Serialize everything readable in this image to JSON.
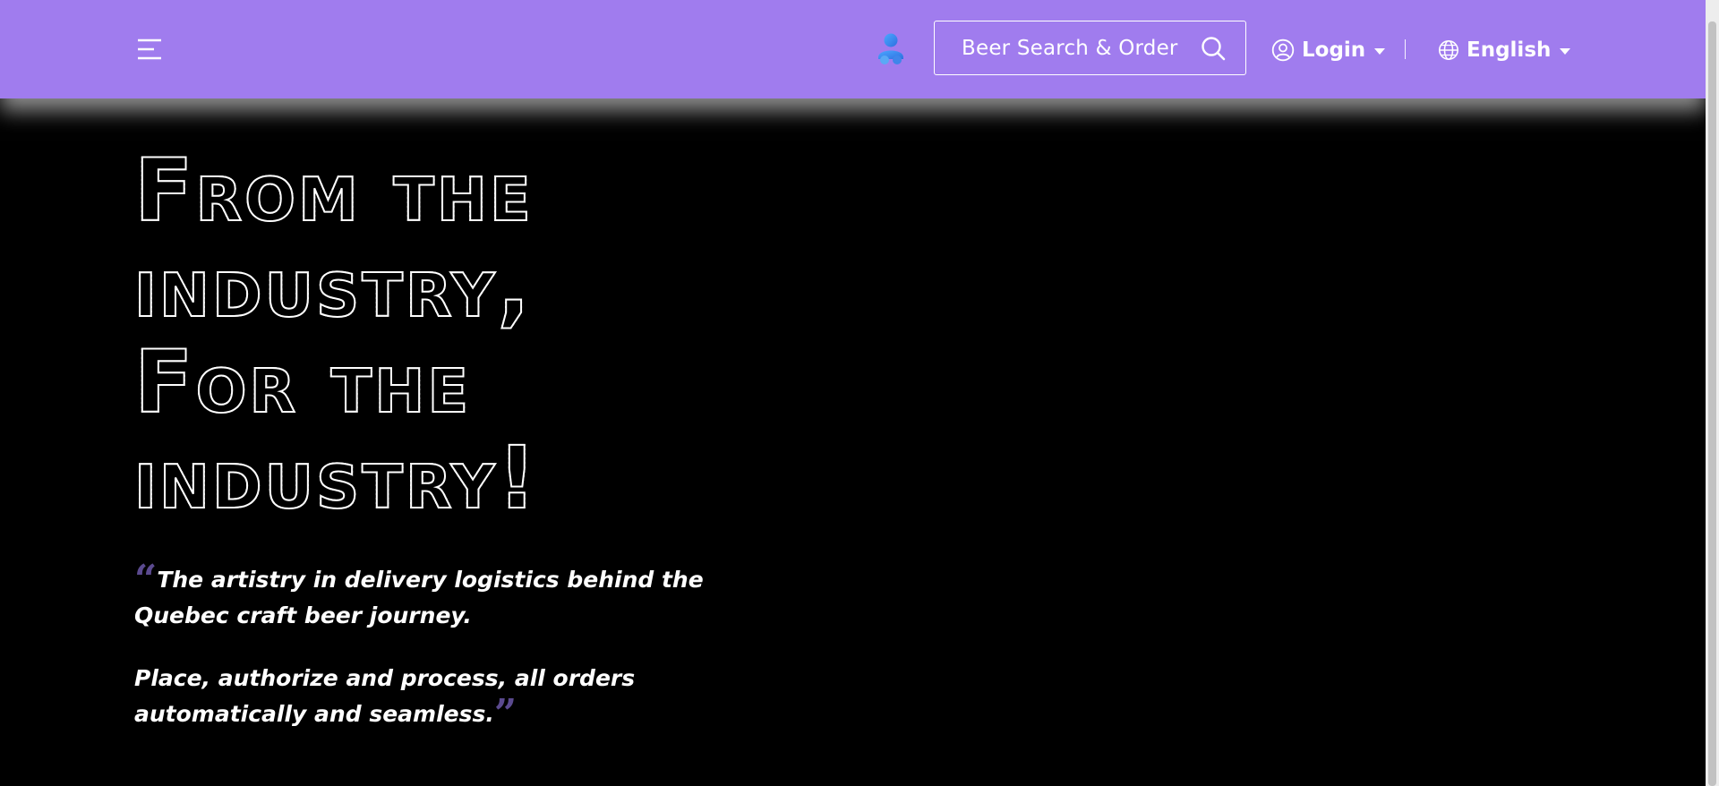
{
  "header": {
    "background_color": "#a07cee",
    "menu_icon": "hamburger-menu-icon",
    "brand_icon": "user-group-icon",
    "search": {
      "placeholder": "Beer Search & Order",
      "icon": "search-icon"
    },
    "login": {
      "label": "Login",
      "icon": "user-circle-icon"
    },
    "language": {
      "label": "English",
      "icon": "globe-icon"
    }
  },
  "hero": {
    "title_lines": [
      "From the",
      "industry,",
      "For the",
      "industry!"
    ],
    "quote_paragraphs": [
      "The artistry in delivery logistics behind the Quebec craft beer journey.",
      "Place, authorize and process, all orders automatically and seamless."
    ],
    "quote_mark_color": "#5b4a8f"
  }
}
